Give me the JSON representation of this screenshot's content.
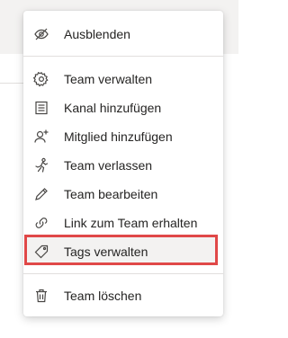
{
  "menu": {
    "items": [
      {
        "label": "Ausblenden",
        "icon": "hide-icon"
      },
      {
        "label": "Team verwalten",
        "icon": "settings-icon"
      },
      {
        "label": "Kanal hinzufügen",
        "icon": "channel-list-icon"
      },
      {
        "label": "Mitglied hinzufügen",
        "icon": "add-person-icon"
      },
      {
        "label": "Team verlassen",
        "icon": "leave-icon"
      },
      {
        "label": "Team bearbeiten",
        "icon": "pencil-icon"
      },
      {
        "label": "Link zum Team erhalten",
        "icon": "link-icon"
      },
      {
        "label": "Tags verwalten",
        "icon": "tag-icon"
      },
      {
        "label": "Team löschen",
        "icon": "trash-icon"
      }
    ],
    "highlighted_item": "Tags verwalten"
  },
  "colors": {
    "text": "#252423",
    "icon": "#484644",
    "highlight_border": "#e04848",
    "highlight_bg": "#f3f2f1",
    "accent": "#6264a7"
  }
}
